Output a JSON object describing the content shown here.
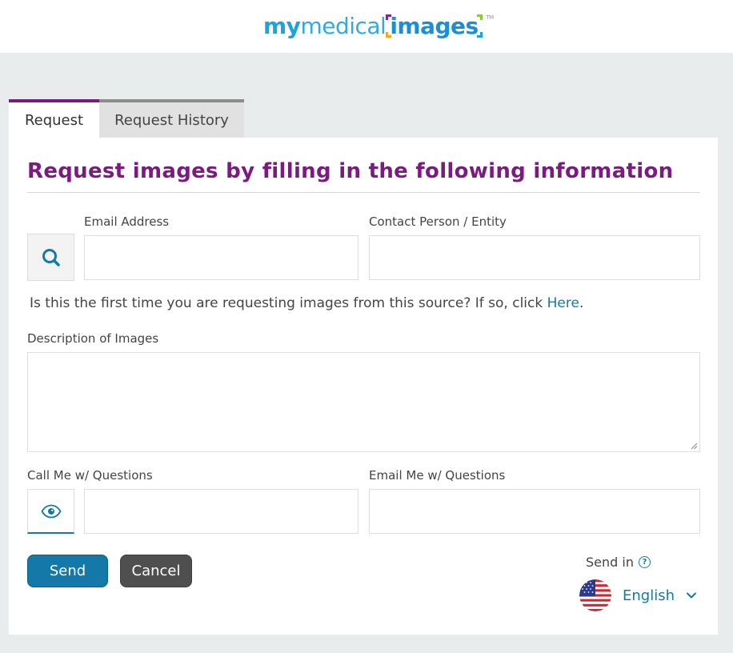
{
  "logo": {
    "my": "my",
    "medical": "medical",
    "images": "images",
    "tm": "TM"
  },
  "tabs": [
    {
      "label": "Request",
      "active": true
    },
    {
      "label": "Request History",
      "active": false
    }
  ],
  "form": {
    "title": "Request images by filling in the following information",
    "email_label": "Email Address",
    "email_value": "",
    "contact_label": "Contact Person / Entity",
    "contact_value": "",
    "first_time_text": "Is this the first time you are requesting images from this source? If so, click ",
    "here_link": "Here",
    "first_time_end": ".",
    "description_label": "Description of Images",
    "description_value": "",
    "call_label": "Call Me w/ Questions",
    "call_value": "",
    "email_me_label": "Email Me w/ Questions",
    "email_me_value": ""
  },
  "actions": {
    "send_label": "Send",
    "cancel_label": "Cancel"
  },
  "language": {
    "send_in_label": "Send in",
    "help_glyph": "?",
    "selected": "English"
  },
  "icons": {
    "search": "search-icon",
    "eye": "eye-icon",
    "help": "help-circle-icon",
    "flag": "us-flag-icon",
    "chevron": "chevron-down-icon"
  },
  "colors": {
    "brand_purple": "#7b1a7f",
    "primary_blue": "#1478a8",
    "cancel_gray": "#4f4f4f",
    "background": "#e9ecec"
  }
}
